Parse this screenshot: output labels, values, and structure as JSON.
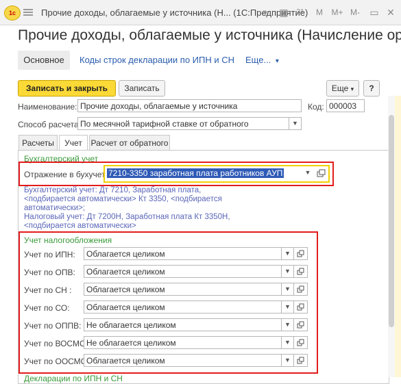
{
  "window": {
    "title": "Прочие доходы, облагаемые у источника (Н... (1С:Предприятие)",
    "logo": "1с",
    "toolbar_icons": [
      "link-icon",
      "spreadsheet-icon",
      "calendar-icon",
      "memory-plus-icon",
      "memory-minus-icon",
      "memory-icon",
      "restore-icon",
      "close-icon"
    ],
    "toolbar_glyphs": [
      "⚭",
      "▦",
      "31",
      "M",
      "M+",
      "M-",
      "▭",
      "✕"
    ],
    "toolbar_glyphs2": [
      "▭",
      "✕"
    ]
  },
  "header": {
    "title": "Прочие доходы, облагаемые у источника (Начисление орг..."
  },
  "nav": {
    "main": "Основное",
    "link1": "Коды строк декларации по ИПН и СН",
    "more": "Еще...",
    "more_arrow": "▾"
  },
  "commands": {
    "save_close": "Записать и закрыть",
    "save": "Записать",
    "more": "Еще",
    "more_arrow": "▾",
    "help": "?"
  },
  "form": {
    "name_label": "Наименование:",
    "name_value": "Прочие доходы, облагаемые у источника",
    "code_label": "Код:",
    "code_value": "000003",
    "calc_label": "Способ расчета:",
    "calc_value": "По месячной тарифной ставке от обратного"
  },
  "tabs": {
    "t1": "Расчеты",
    "t2": "Учет",
    "t3": "Расчет от обратного"
  },
  "accounting": {
    "group_title": "Бухгалтерский учет",
    "reflection_label": "Отражение в бухучете:",
    "reflection_value": "7210-3350 заработная плата работников АУП",
    "info_line1": "Бухгалтерский учет: Дт 7210, Заработная плата,",
    "info_line2": "<подбирается автоматически> Кт 3350, <подбирается",
    "info_line3": "автоматически>;",
    "info_line4": "Налоговый учет: Дт 7200Н, Заработная плата Кт 3350Н,",
    "info_line5": "<подбирается автоматически>"
  },
  "taxation": {
    "group_title": "Учет налогообложения",
    "rows": [
      {
        "label": "Учет по ИПН:",
        "value": "Облагается целиком"
      },
      {
        "label": "Учет по ОПВ:",
        "value": "Облагается целиком"
      },
      {
        "label": "Учет по СН :",
        "value": "Облагается целиком"
      },
      {
        "label": "Учет по СО:",
        "value": "Облагается целиком"
      },
      {
        "label": "Учет по ОППВ:",
        "value": "Не облагается целиком"
      },
      {
        "label": "Учет по ВОСМС:",
        "value": "Не облагается целиком"
      },
      {
        "label": "Учет по ООСМС:",
        "value": "Облагается целиком"
      }
    ]
  },
  "footer": {
    "next_group": "Декларации по ИПН и СН"
  },
  "colors": {
    "accent_yellow": "#fbd936",
    "highlight_red": "#e31b1b",
    "highlight_yellow": "#f2d000",
    "link_blue": "#2a5cad",
    "group_green": "#3a9a3a",
    "info_purple": "#5a66b8",
    "selection_blue": "#2f5bb7"
  }
}
